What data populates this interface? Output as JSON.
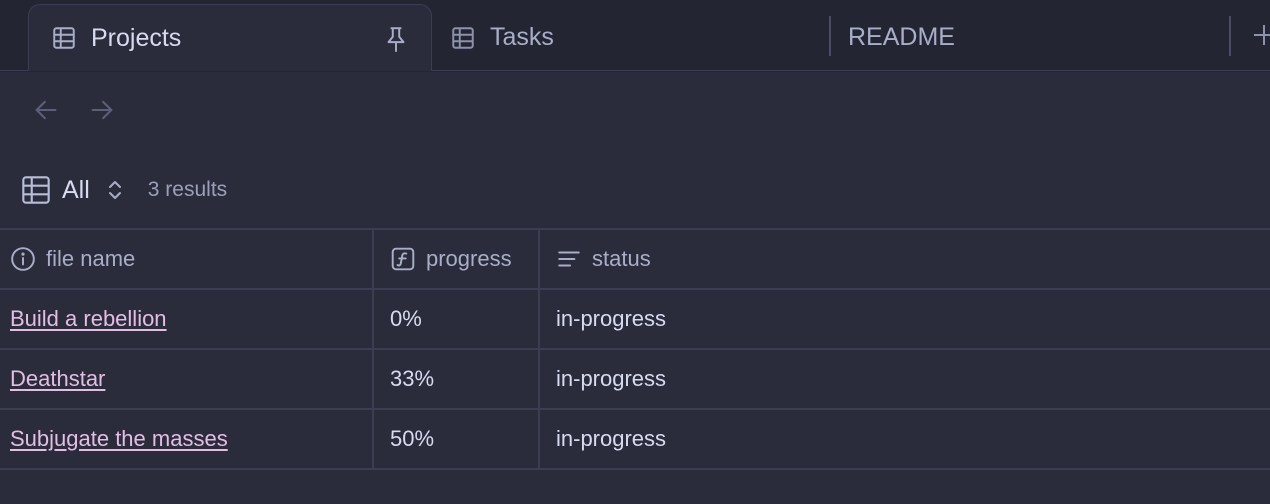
{
  "tabs": [
    {
      "label": "Projects",
      "icon": "table-icon",
      "pinned": true,
      "active": true
    },
    {
      "label": "Tasks",
      "icon": "table-icon",
      "active": false
    },
    {
      "label": "README",
      "active": false
    }
  ],
  "view": {
    "name": "All",
    "result_count": "3 results"
  },
  "table": {
    "columns": [
      {
        "label": "file name",
        "icon": "info-icon"
      },
      {
        "label": "progress",
        "icon": "formula-icon"
      },
      {
        "label": "status",
        "icon": "text-lines-icon"
      }
    ],
    "rows": [
      {
        "file_name": "Build a rebellion",
        "progress": "0%",
        "status": "in-progress"
      },
      {
        "file_name": "Deathstar",
        "progress": "33%",
        "status": "in-progress"
      },
      {
        "file_name": "Subjugate the masses",
        "progress": "50%",
        "status": "in-progress"
      }
    ]
  },
  "colors": {
    "background": "#2a2c3c",
    "tabbar": "#232533",
    "link": "#e4bde3",
    "text": "#d7dbef",
    "muted": "#a9aec8"
  }
}
